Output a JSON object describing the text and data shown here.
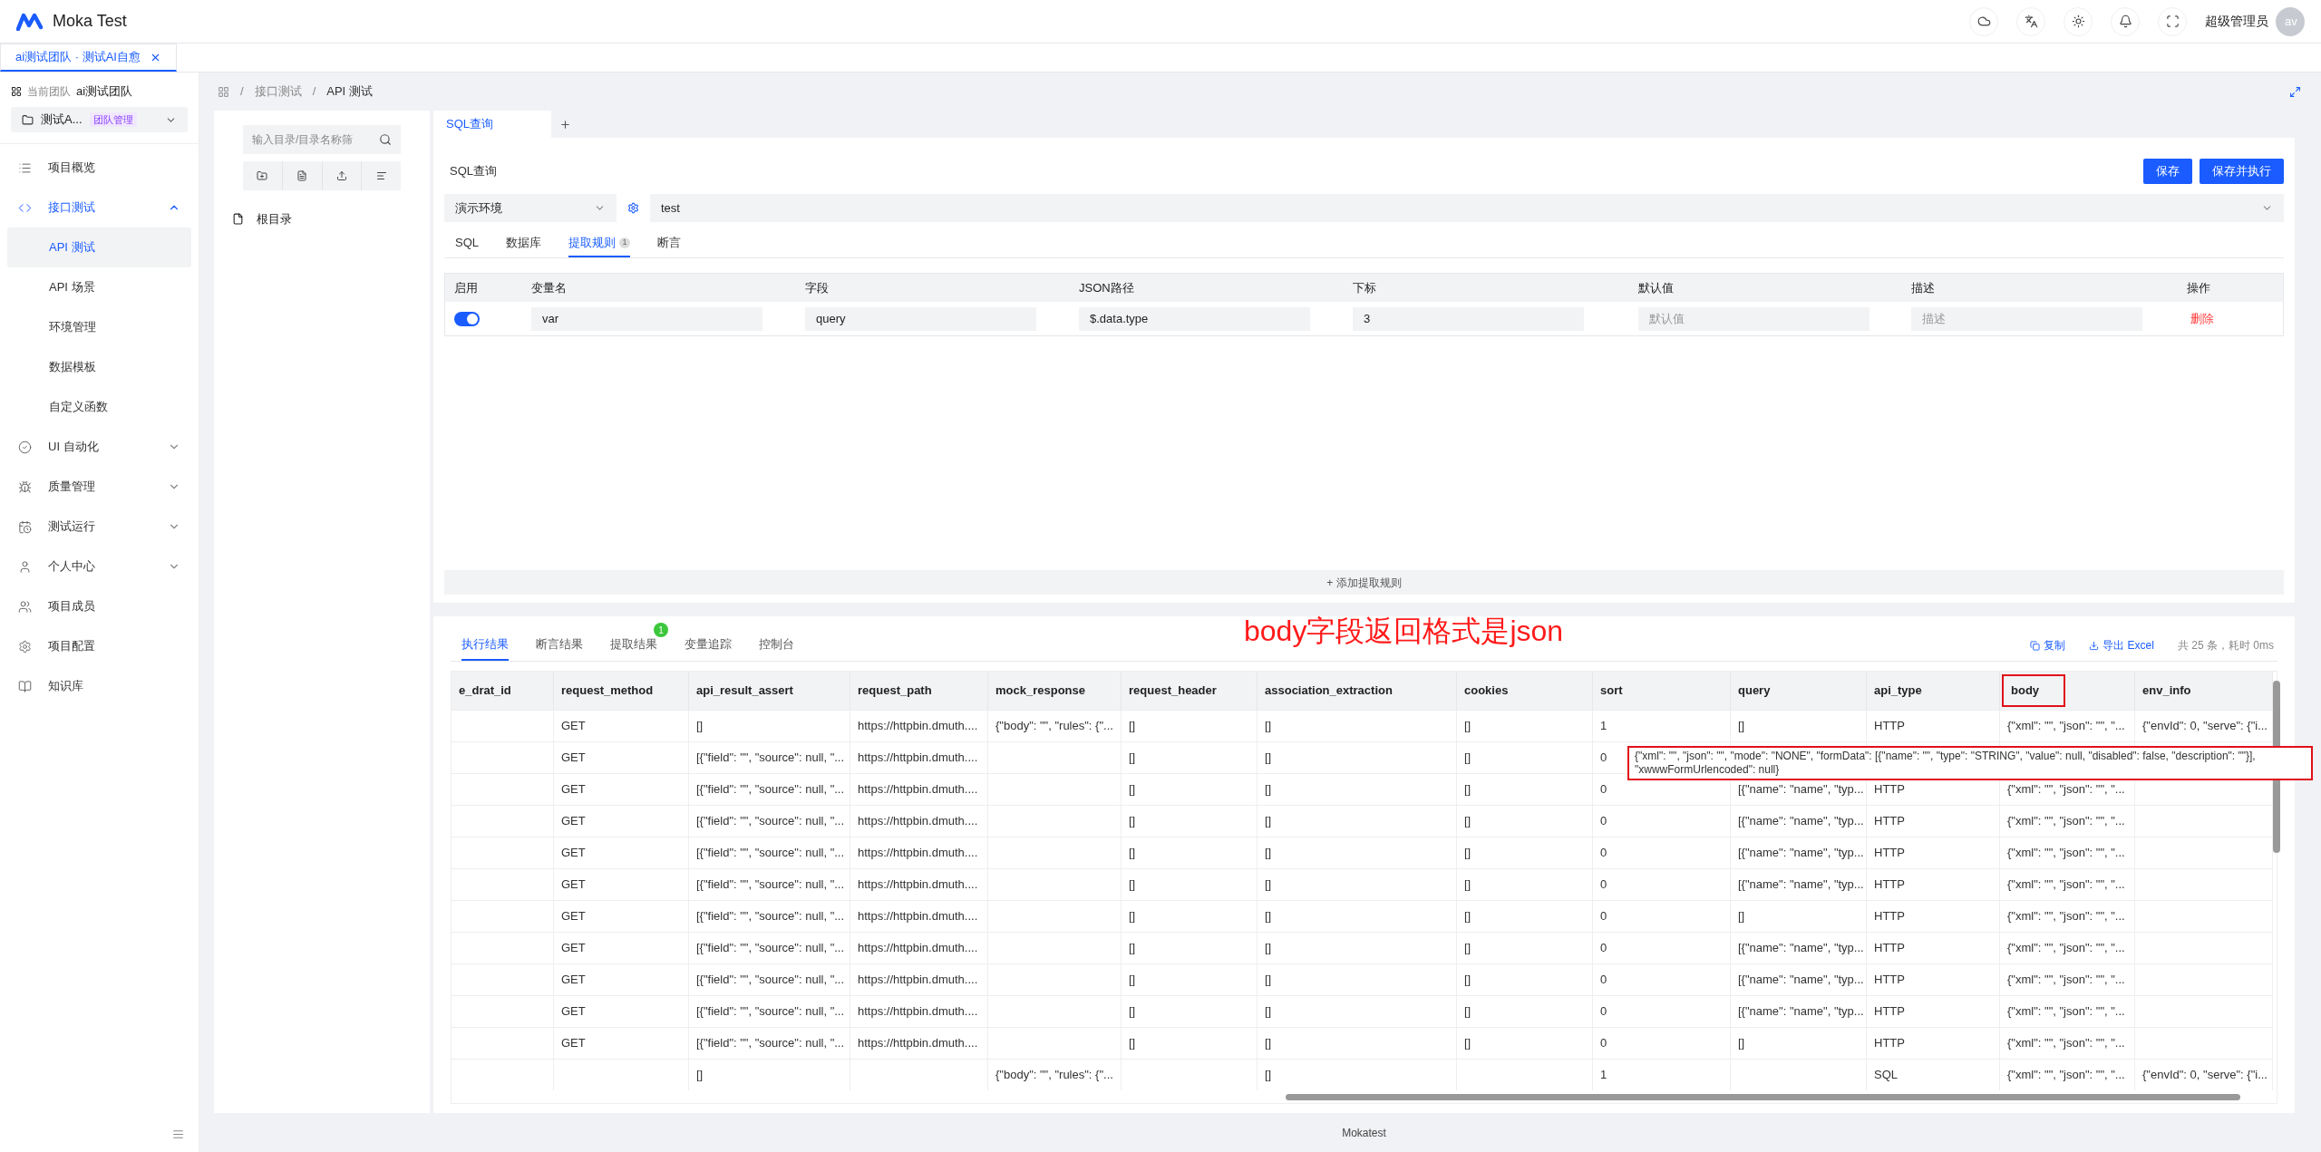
{
  "header": {
    "app_name": "Moka Test",
    "user": "超级管理员",
    "avatar_text": "av"
  },
  "page_tabs": [
    {
      "label": "ai测试团队 · 测试AI自愈",
      "selected": true
    }
  ],
  "sidebar": {
    "team_label": "当前团队",
    "team_name": "ai测试团队",
    "project": "测试A...",
    "project_tag": "团队管理",
    "items": [
      {
        "kind": "link",
        "label": "项目概览",
        "selected": false
      },
      {
        "kind": "group",
        "label": "接口测试",
        "selected": true,
        "expanded": true,
        "children": [
          {
            "label": "API 测试",
            "selected": true
          },
          {
            "label": "API 场景",
            "selected": false
          },
          {
            "label": "环境管理",
            "selected": false
          },
          {
            "label": "数据模板",
            "selected": false
          },
          {
            "label": "自定义函数",
            "selected": false
          }
        ]
      },
      {
        "kind": "group",
        "label": "UI 自动化",
        "selected": false,
        "expanded": false
      },
      {
        "kind": "group",
        "label": "质量管理",
        "selected": false,
        "expanded": false
      },
      {
        "kind": "group",
        "label": "测试运行",
        "selected": false,
        "expanded": false
      },
      {
        "kind": "group",
        "label": "个人中心",
        "selected": false,
        "expanded": false
      },
      {
        "kind": "link",
        "label": "项目成员",
        "selected": false
      },
      {
        "kind": "link",
        "label": "项目配置",
        "selected": false
      },
      {
        "kind": "link",
        "label": "知识库",
        "selected": false
      }
    ]
  },
  "breadcrumb": {
    "separator": "/",
    "items": [
      "接口测试",
      "API 测试"
    ]
  },
  "tree": {
    "search_placeholder": "输入目录/目录名称筛",
    "nodes": [
      {
        "label": "根目录"
      }
    ]
  },
  "editor_tabs": [
    {
      "label": "SQL查询",
      "selected": true
    }
  ],
  "query_title": "SQL查询",
  "buttons": [
    "保存",
    "保存并执行"
  ],
  "environment": {
    "value": "演示环境"
  },
  "datasource": {
    "value": "test"
  },
  "sub_tabs": [
    {
      "label": "SQL",
      "selected": false
    },
    {
      "label": "数据库",
      "selected": false
    },
    {
      "label": "提取规则",
      "selected": true,
      "badge": "1"
    },
    {
      "label": "断言",
      "selected": false
    }
  ],
  "rules_table": {
    "columns": [
      "启用",
      "变量名",
      "字段",
      "JSON路径",
      "下标",
      "默认值",
      "描述",
      "操作"
    ],
    "rows": [
      {
        "enabled": true,
        "variable": "var",
        "field": "query",
        "json_path": "$.data.type",
        "index": "3",
        "default_placeholder": "默认值",
        "description_placeholder": "描述",
        "action": "删除"
      }
    ]
  },
  "add_rule_button": "+ 添加提取规则",
  "result_tabs": [
    {
      "label": "执行结果",
      "selected": true
    },
    {
      "label": "断言结果",
      "selected": false
    },
    {
      "label": "提取结果",
      "selected": false,
      "badge": "1"
    },
    {
      "label": "变量追踪",
      "selected": false
    },
    {
      "label": "控制台",
      "selected": false
    }
  ],
  "annotation": "body字段返回格式是json",
  "result_actions": {
    "copy": "复制",
    "export": "导出 Excel",
    "summary": "共 25 条，耗时 0ms"
  },
  "result_table": {
    "columns": [
      {
        "label": "e_drat_id",
        "highlighted": false
      },
      {
        "label": "request_method",
        "highlighted": false
      },
      {
        "label": "api_result_assert",
        "highlighted": false
      },
      {
        "label": "request_path",
        "highlighted": false
      },
      {
        "label": "mock_response",
        "highlighted": false
      },
      {
        "label": "request_header",
        "highlighted": false
      },
      {
        "label": "association_extraction",
        "highlighted": false
      },
      {
        "label": "cookies",
        "highlighted": false
      },
      {
        "label": "sort",
        "highlighted": false
      },
      {
        "label": "query",
        "highlighted": false
      },
      {
        "label": "api_type",
        "highlighted": false
      },
      {
        "label": "body",
        "highlighted": true
      },
      {
        "label": "env_info",
        "highlighted": false
      }
    ],
    "rows": [
      [
        "",
        "GET",
        "[]",
        "https://httpbin.dmuth....",
        "{\"body\": \"\", \"rules\": {\"...",
        "[]",
        "[]",
        "[]",
        "1",
        "[]",
        "HTTP",
        "{\"xml\": \"\", \"json\": \"\", \"...",
        "{\"envId\": 0, \"serve\": {\"i..."
      ],
      [
        "",
        "GET",
        "[{\"field\": \"\", \"source\": null, \"...",
        "https://httpbin.dmuth....",
        "",
        "[]",
        "[]",
        "[]",
        "0"
      ],
      [
        "",
        "GET",
        "[{\"field\": \"\", \"source\": null, \"...",
        "https://httpbin.dmuth....",
        "",
        "[]",
        "[]",
        "[]",
        "0",
        "[{\"name\": \"name\", \"typ...",
        "HTTP",
        "{\"xml\": \"\", \"json\": \"\", \"...",
        ""
      ],
      [
        "",
        "GET",
        "[{\"field\": \"\", \"source\": null, \"...",
        "https://httpbin.dmuth....",
        "",
        "[]",
        "[]",
        "[]",
        "0",
        "[{\"name\": \"name\", \"typ...",
        "HTTP",
        "{\"xml\": \"\", \"json\": \"\", \"...",
        ""
      ],
      [
        "",
        "GET",
        "[{\"field\": \"\", \"source\": null, \"...",
        "https://httpbin.dmuth....",
        "",
        "[]",
        "[]",
        "[]",
        "0",
        "[{\"name\": \"name\", \"typ...",
        "HTTP",
        "{\"xml\": \"\", \"json\": \"\", \"...",
        ""
      ],
      [
        "",
        "GET",
        "[{\"field\": \"\", \"source\": null, \"...",
        "https://httpbin.dmuth....",
        "",
        "[]",
        "[]",
        "[]",
        "0",
        "[{\"name\": \"name\", \"typ...",
        "HTTP",
        "{\"xml\": \"\", \"json\": \"\", \"...",
        ""
      ],
      [
        "",
        "GET",
        "[{\"field\": \"\", \"source\": null, \"...",
        "https://httpbin.dmuth....",
        "",
        "[]",
        "[]",
        "[]",
        "0",
        "[]",
        "HTTP",
        "{\"xml\": \"\", \"json\": \"\", \"...",
        ""
      ],
      [
        "",
        "GET",
        "[{\"field\": \"\", \"source\": null, \"...",
        "https://httpbin.dmuth....",
        "",
        "[]",
        "[]",
        "[]",
        "0",
        "[{\"name\": \"name\", \"typ...",
        "HTTP",
        "{\"xml\": \"\", \"json\": \"\", \"...",
        ""
      ],
      [
        "",
        "GET",
        "[{\"field\": \"\", \"source\": null, \"...",
        "https://httpbin.dmuth....",
        "",
        "[]",
        "[]",
        "[]",
        "0",
        "[{\"name\": \"name\", \"typ...",
        "HTTP",
        "{\"xml\": \"\", \"json\": \"\", \"...",
        ""
      ],
      [
        "",
        "GET",
        "[{\"field\": \"\", \"source\": null, \"...",
        "https://httpbin.dmuth....",
        "",
        "[]",
        "[]",
        "[]",
        "0",
        "[{\"name\": \"name\", \"typ...",
        "HTTP",
        "{\"xml\": \"\", \"json\": \"\", \"...",
        ""
      ],
      [
        "",
        "GET",
        "[{\"field\": \"\", \"source\": null, \"...",
        "https://httpbin.dmuth....",
        "",
        "[]",
        "[]",
        "[]",
        "0",
        "[]",
        "HTTP",
        "{\"xml\": \"\", \"json\": \"\", \"...",
        ""
      ],
      [
        "",
        "",
        "[]",
        "",
        "{\"body\": \"\", \"rules\": {\"...",
        "",
        "[]",
        "",
        "1",
        "",
        "SQL",
        "{\"xml\": \"\", \"json\": \"\", \"...",
        "{\"envId\": 0, \"serve\": {\"i..."
      ]
    ],
    "tooltip": {
      "text": "{\"xml\": \"\", \"json\": \"\", \"mode\": \"NONE\", \"formData\": [{\"name\": \"\", \"type\": \"STRING\", \"value\": null, \"disabled\": false, \"description\": \"\"}], \"xwwwFormUrlencoded\": null}"
    }
  },
  "footer": "Mokatest"
}
